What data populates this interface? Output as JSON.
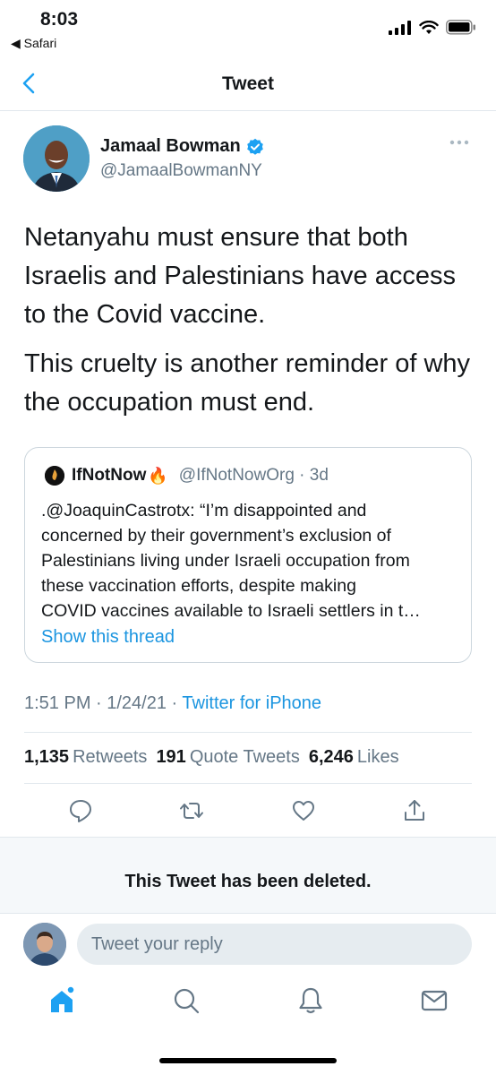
{
  "status_bar": {
    "time": "8:03",
    "back_app": "◀ Safari"
  },
  "nav": {
    "title": "Tweet"
  },
  "tweet": {
    "author_name": "Jamaal Bowman",
    "author_handle": "@JamaalBowmanNY",
    "paragraphs": [
      "Netanyahu must ensure that both Israelis and Palestinians have access to the Covid vaccine.",
      "This cruelty is another reminder of why the occupation must end."
    ],
    "timestamp": "1:51 PM · 1/24/21 · ",
    "source": "Twitter for iPhone"
  },
  "quote": {
    "name": "IfNotNow",
    "fire": "🔥",
    "handle_time": "@IfNotNowOrg · 3d",
    "lines": [
      ".@JoaquinCastrotx: “I’m disappointed and",
      "concerned by their government’s exclusion of",
      "Palestinians living under Israeli occupation from",
      "these vaccination efforts, despite making",
      "COVID vaccines available to Israeli settlers in t…"
    ],
    "show_thread": "Show this thread"
  },
  "stats": {
    "retweets_count": "1,135",
    "retweets_label": "Retweets",
    "quotes_count": "191",
    "quotes_label": "Quote Tweets",
    "likes_count": "6,246",
    "likes_label": "Likes"
  },
  "deleted_notice": "This Tweet has been deleted.",
  "reply": {
    "placeholder": "Tweet your reply"
  },
  "colors": {
    "accent": "#1da1f2",
    "muted": "#657786",
    "border": "#e1e8ed"
  },
  "icons": [
    "chevron-left-icon",
    "verified-badge-icon",
    "more-icon",
    "reply-icon",
    "retweet-icon",
    "like-icon",
    "share-icon",
    "home-icon",
    "search-icon",
    "notifications-icon",
    "messages-icon"
  ]
}
